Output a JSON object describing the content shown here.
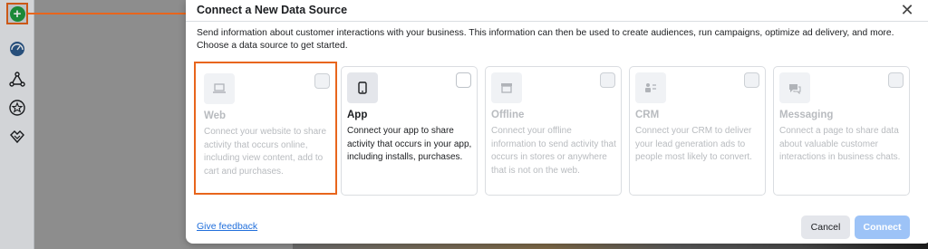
{
  "rail": {
    "add_symbol": "+",
    "icons": [
      "dashboard-icon",
      "network-icon",
      "star-icon",
      "handshake-icon"
    ]
  },
  "modal": {
    "title": "Connect a New Data Source",
    "close_symbol": "✕",
    "intro": "Send information about customer interactions with your business. This information can then be used to create audiences, run campaigns, optimize ad delivery, and more. Choose a data source to get started.",
    "cards": [
      {
        "title": "Web",
        "icon": "laptop-icon",
        "description": "Connect your website to share activity that occurs online, including view content, add to cart and purchases.",
        "state": "disabled"
      },
      {
        "title": "App",
        "icon": "phone-icon",
        "description": "Connect your app to share activity that occurs in your app, including installs, purchases.",
        "state": "enabled"
      },
      {
        "title": "Offline",
        "icon": "store-icon",
        "description": "Connect your offline information to send activity that occurs in stores or anywhere that is not on the web.",
        "state": "disabled"
      },
      {
        "title": "CRM",
        "icon": "crm-icon",
        "description": "Connect your CRM to deliver your lead generation ads to people most likely to convert.",
        "state": "disabled"
      },
      {
        "title": "Messaging",
        "icon": "chat-icon",
        "description": "Connect a page to share data about valuable customer interactions in business chats.",
        "state": "disabled"
      }
    ],
    "feedback_link": "Give feedback",
    "cancel_label": "Cancel",
    "connect_label": "Connect"
  },
  "colors": {
    "highlight": "#e8651c",
    "link": "#216fdb",
    "connect_disabled": "#9dc3f7",
    "add_green": "#1f9d3f"
  }
}
